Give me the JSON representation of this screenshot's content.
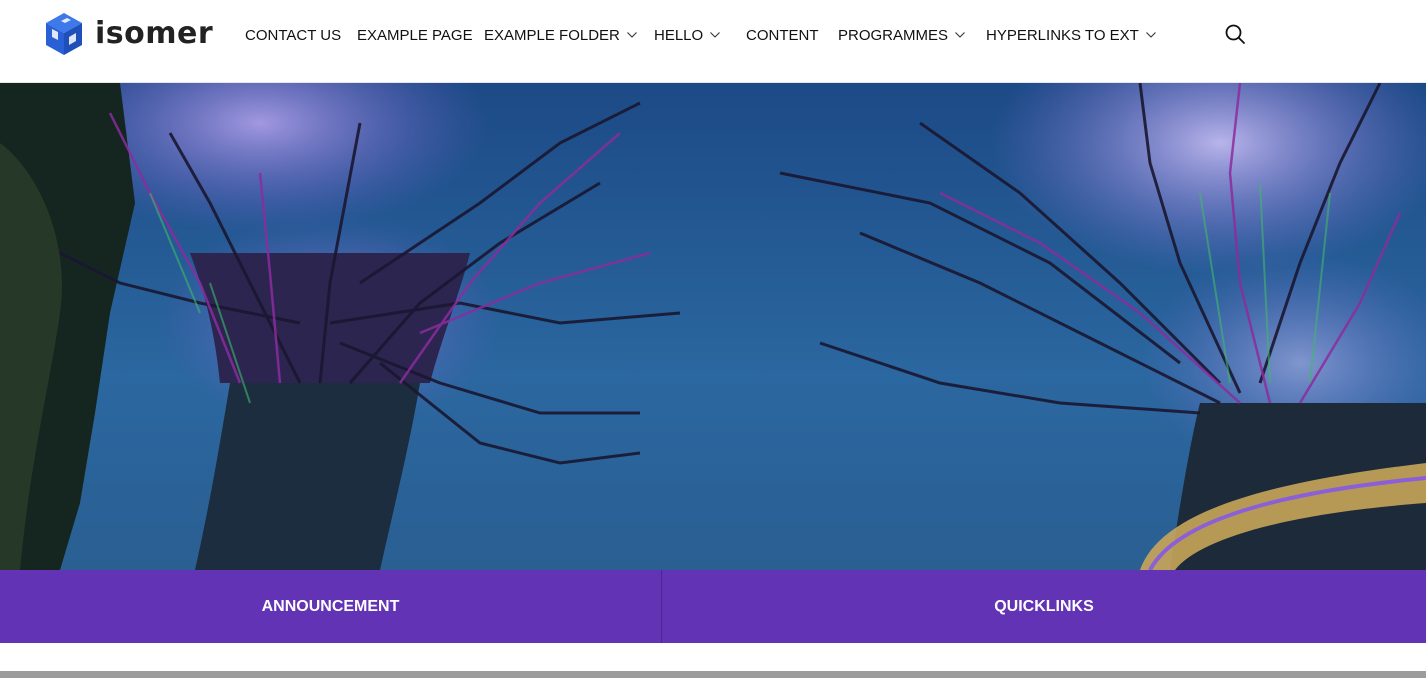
{
  "site": {
    "logo_text": "isomer",
    "brand_color": "#6233b4",
    "logo_color": "#2a60d6"
  },
  "nav": {
    "items": [
      {
        "label": "CONTACT US",
        "has_dropdown": false
      },
      {
        "label": "EXAMPLE PAGE",
        "has_dropdown": false
      },
      {
        "label": "EXAMPLE FOLDER",
        "has_dropdown": true
      },
      {
        "label": "HELLO",
        "has_dropdown": true
      },
      {
        "label": "CONTENT",
        "has_dropdown": false
      },
      {
        "label": "PROGRAMMES",
        "has_dropdown": true
      },
      {
        "label": "HYPERLINKS TO EXT",
        "has_dropdown": true
      }
    ],
    "search_icon": "search-icon"
  },
  "hero": {
    "image_subject": "supertree-structures-at-dusk"
  },
  "buttons": {
    "announcement_label": "ANNOUNCEMENT",
    "quicklinks_label": "QUICKLINKS"
  }
}
